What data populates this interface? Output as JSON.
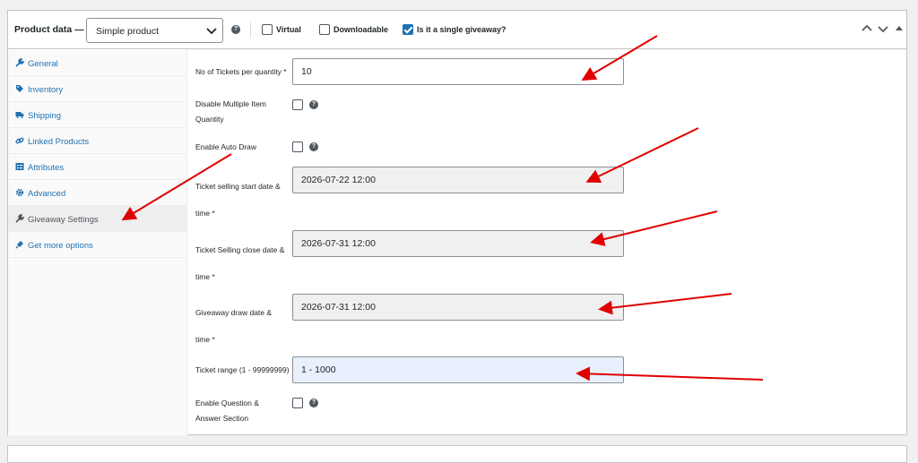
{
  "header": {
    "title": "Product data —",
    "product_type": "Simple product",
    "virtual_label": "Virtual",
    "downloadable_label": "Downloadable",
    "single_giveaway_label": "Is it a single giveaway?",
    "virtual_checked": false,
    "downloadable_checked": false,
    "single_giveaway_checked": true
  },
  "sidebar": {
    "items": [
      {
        "label": "General",
        "icon": "wrench-icon",
        "active": false
      },
      {
        "label": "Inventory",
        "icon": "tag-icon",
        "active": false
      },
      {
        "label": "Shipping",
        "icon": "truck-icon",
        "active": false
      },
      {
        "label": "Linked Products",
        "icon": "link-icon",
        "active": false
      },
      {
        "label": "Attributes",
        "icon": "list-icon",
        "active": false
      },
      {
        "label": "Advanced",
        "icon": "gear-icon",
        "active": false
      },
      {
        "label": "Giveaway Settings",
        "icon": "wrench-icon",
        "active": true
      },
      {
        "label": "Get more options",
        "icon": "plugin-icon",
        "active": false
      }
    ]
  },
  "fields": {
    "tickets_per_qty": {
      "label": "No of Tickets per quantity *",
      "value": "10"
    },
    "disable_multiple": {
      "label": "Disable Multiple Item Quantity",
      "checked": false
    },
    "auto_draw": {
      "label": "Enable Auto Draw",
      "checked": false
    },
    "start_date": {
      "label": "Ticket selling start date & time *",
      "value": "2026-07-22 12:00"
    },
    "close_date": {
      "label": "Ticket Selling close date & time *",
      "value": "2026-07-31 12:00"
    },
    "draw_date": {
      "label": "Giveaway draw date & time *",
      "value": "2026-07-31 12:00"
    },
    "ticket_range": {
      "label": "Ticket range (1 - 99999999)",
      "value": "1 - 1000"
    },
    "qa_section": {
      "label": "Enable Question & Answer Section",
      "checked": false
    }
  },
  "colors": {
    "accent": "#2271b1",
    "annotation_arrow": "#e00000",
    "readonly_bg": "#f0f0f1",
    "highlight_bg": "#e8f0fe"
  }
}
